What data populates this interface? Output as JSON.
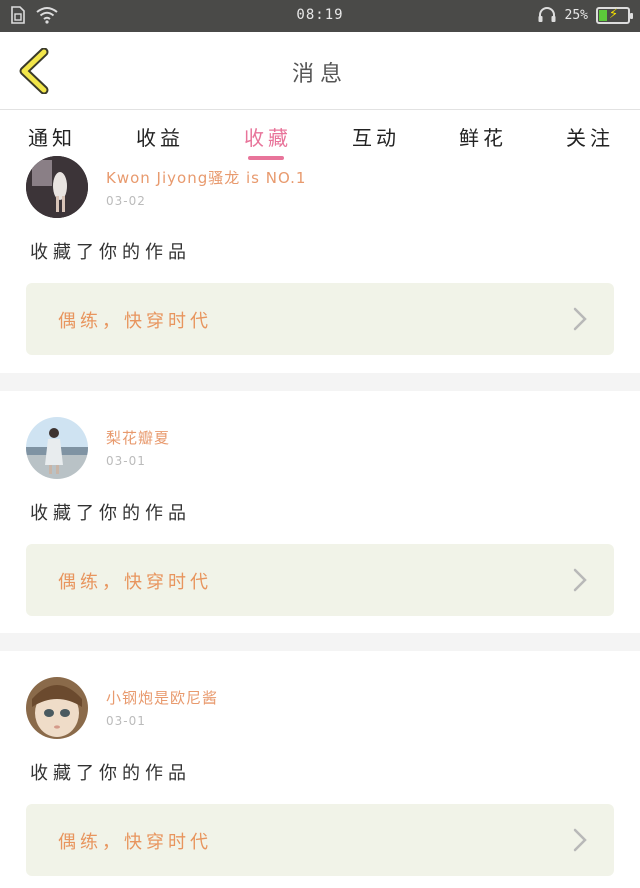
{
  "status_bar": {
    "time": "08:19",
    "battery_percent": "25%",
    "battery_level": 0.25,
    "icons": [
      "sim-card-icon",
      "wifi-icon",
      "headset-icon",
      "battery-icon"
    ]
  },
  "header": {
    "title": "消息",
    "back_icon": "chevron-left-icon"
  },
  "tabs": [
    {
      "label": "通知",
      "active": false
    },
    {
      "label": "收益",
      "active": false
    },
    {
      "label": "收藏",
      "active": true
    },
    {
      "label": "互动",
      "active": false
    },
    {
      "label": "鲜花",
      "active": false
    },
    {
      "label": "关注",
      "active": false
    }
  ],
  "colors": {
    "accent": "#e8749a",
    "username": "#e89a6e",
    "work_title": "#e8955e",
    "card_bg": "#f1f3e8",
    "status_bar_bg": "#4a4a48"
  },
  "items": [
    {
      "username": "Kwon Jiyong骚龙 is NO.1",
      "date": "03-02",
      "action": "收藏了你的作品",
      "work_title": "偶练，快穿时代"
    },
    {
      "username": "梨花瓣夏",
      "date": "03-01",
      "action": "收藏了你的作品",
      "work_title": "偶练，快穿时代"
    },
    {
      "username": "小钢炮是欧尼酱",
      "date": "03-01",
      "action": "收藏了你的作品",
      "work_title": "偶练，快穿时代"
    }
  ]
}
